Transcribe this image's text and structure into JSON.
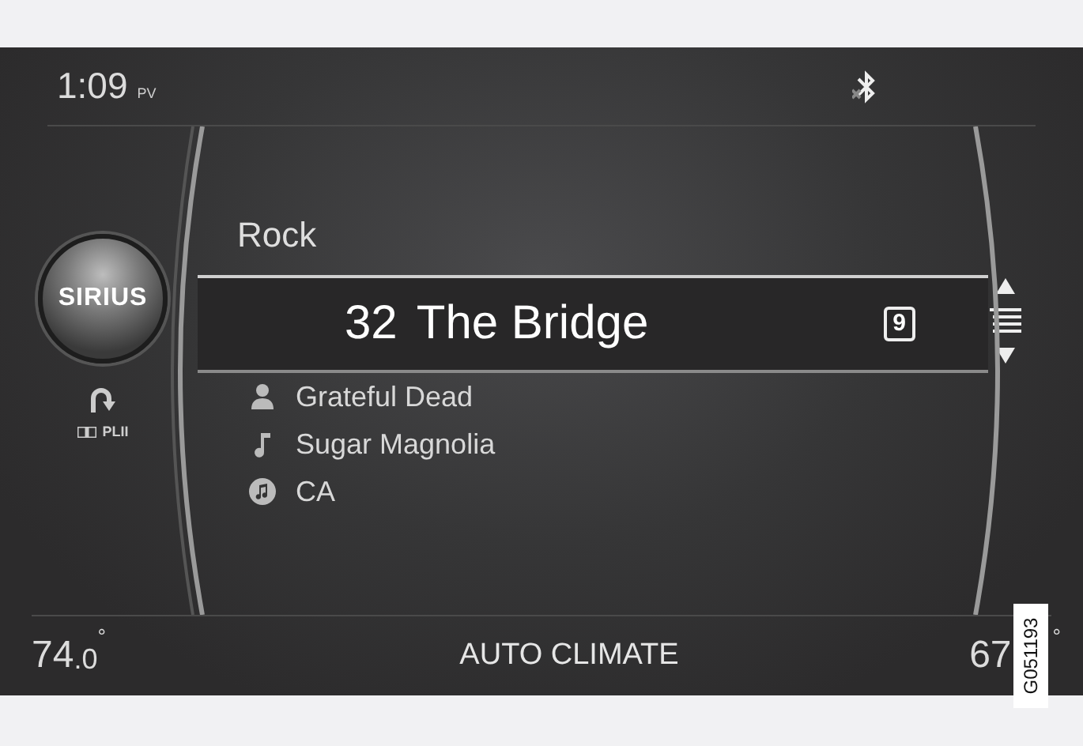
{
  "status_bar": {
    "time": "1:09",
    "time_suffix": "PV"
  },
  "source": {
    "logo": "SIRIUS",
    "sound_mode": "PLII"
  },
  "channel": {
    "category": "Rock",
    "number": "32",
    "name": "The Bridge",
    "preset": "9"
  },
  "track_info": [
    {
      "kind": "artist",
      "text": "Grateful Dead"
    },
    {
      "kind": "song",
      "text": "Sugar Magnolia"
    },
    {
      "kind": "content",
      "text": "CA"
    }
  ],
  "climate": {
    "left_temp": "74",
    "left_decimal": ".0",
    "left_degree": "°",
    "mode": "AUTO CLIMATE",
    "right_temp": "67",
    "right_degree": "°"
  },
  "figure_label": "G051193"
}
